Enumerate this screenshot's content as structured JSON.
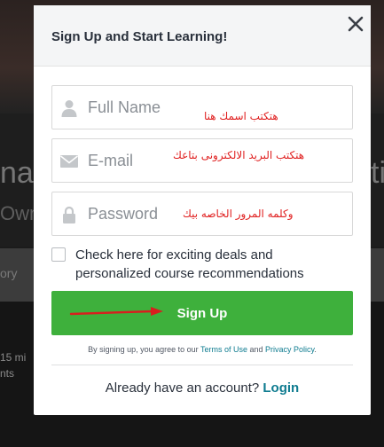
{
  "background": {
    "text_1": "nat",
    "text_2": "Own",
    "text_3": "ory",
    "text_4a": "15 mi",
    "text_4b": "nts",
    "text_right": "ti"
  },
  "modal": {
    "title": "Sign Up and Start Learning!",
    "close_icon": "close-icon"
  },
  "fields": {
    "full_name": {
      "placeholder": "Full Name",
      "value": "",
      "icon": "user-icon",
      "annotation": "هتكتب اسمك هنا"
    },
    "email": {
      "placeholder": "E-mail",
      "value": "",
      "icon": "envelope-icon",
      "annotation": "هتكتب البريد الالكترونى بتاعك"
    },
    "password": {
      "placeholder": "Password",
      "value": "",
      "icon": "lock-icon",
      "annotation": "وكلمه المرور الخاصه بيك"
    }
  },
  "offers_checkbox": {
    "label": "Check here for exciting deals and personalized course recommendations",
    "checked": false
  },
  "signup": {
    "label": "Sign Up"
  },
  "terms": {
    "prefix": "By signing up, you agree to our ",
    "terms_link": "Terms of Use",
    "middle": " and ",
    "privacy_link": "Privacy Policy",
    "suffix": "."
  },
  "login": {
    "prompt": "Already have an account? ",
    "link": "Login"
  },
  "colors": {
    "accent_green": "#3eb03c",
    "link_teal": "#0f7c90",
    "annotation_red": "#e02020",
    "overlay_dark": "#1b1b1b"
  }
}
